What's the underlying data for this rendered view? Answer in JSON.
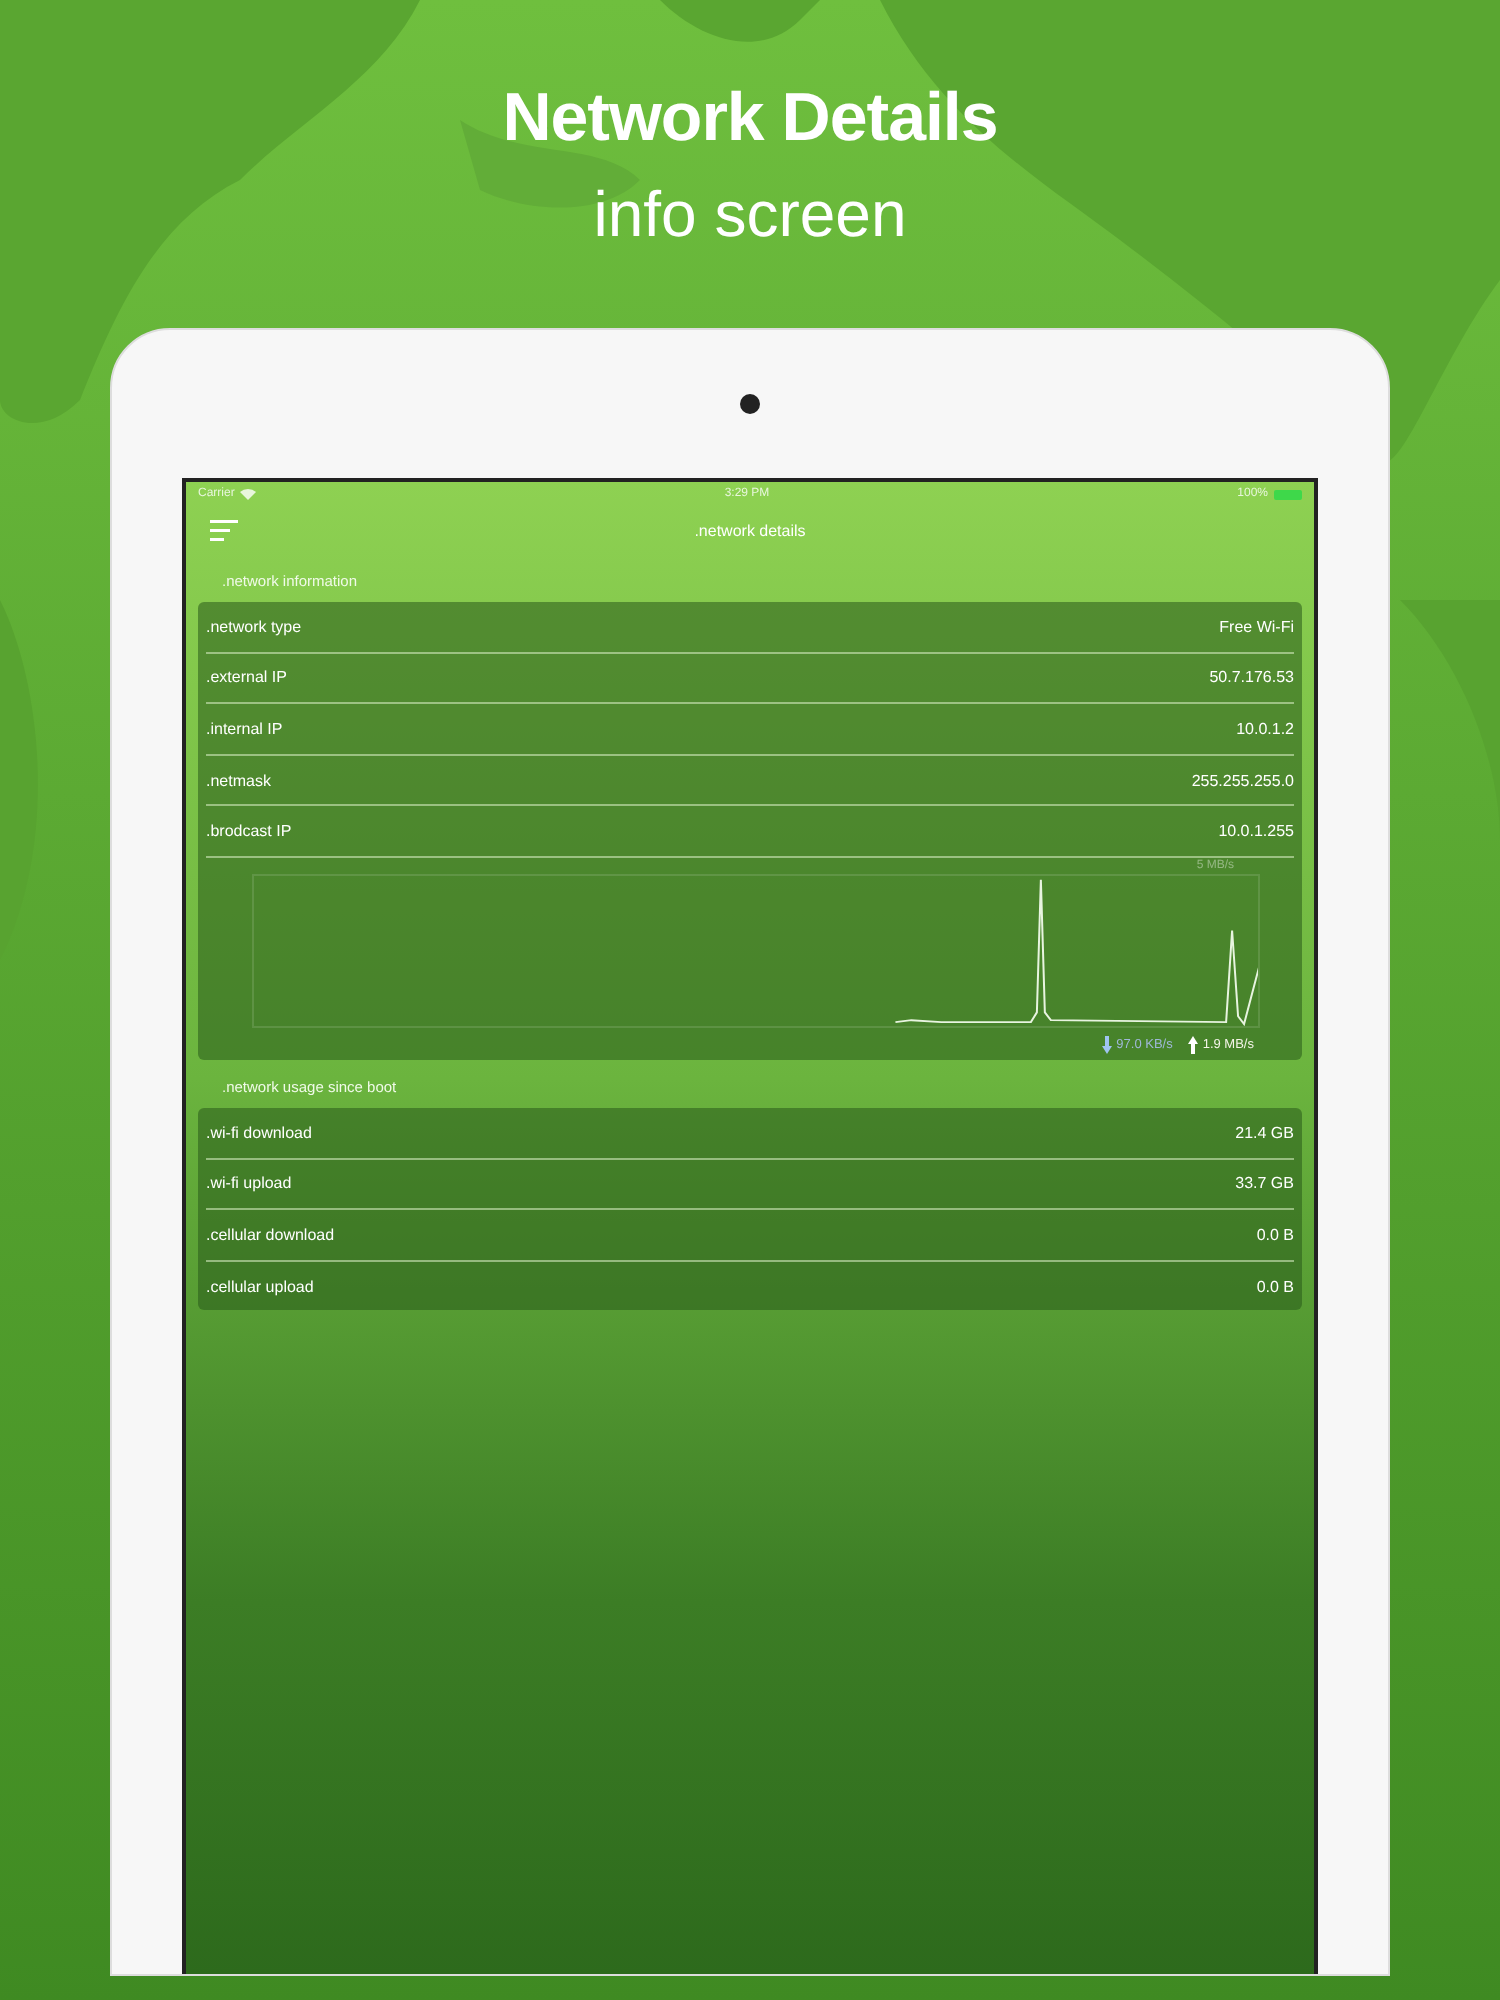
{
  "header": {
    "title": "Network Details",
    "subtitle": "info screen"
  },
  "status_bar": {
    "carrier": "Carrier",
    "time": "3:29 PM",
    "battery": "100%"
  },
  "nav": {
    "title": ".network details"
  },
  "sections": [
    {
      "title": ".network information",
      "rows": [
        {
          "label": ".network type",
          "value": "Free Wi-Fi"
        },
        {
          "label": ".external IP",
          "value": "50.7.176.53"
        },
        {
          "label": ".internal IP",
          "value": "10.0.1.2"
        },
        {
          "label": ".netmask",
          "value": "255.255.255.0"
        },
        {
          "label": ".brodcast IP",
          "value": "10.0.1.255"
        }
      ],
      "graph": {
        "top_label": "5 MB/s",
        "download": "97.0 KB/s",
        "upload": "1.9 MB/s"
      }
    },
    {
      "title": ".network usage since boot",
      "rows": [
        {
          "label": ".wi-fi download",
          "value": "21.4 GB"
        },
        {
          "label": ".wi-fi upload",
          "value": "33.7 GB"
        },
        {
          "label": ".cellular download",
          "value": "0.0 B"
        },
        {
          "label": ".cellular upload",
          "value": "0.0 B"
        }
      ]
    }
  ]
}
